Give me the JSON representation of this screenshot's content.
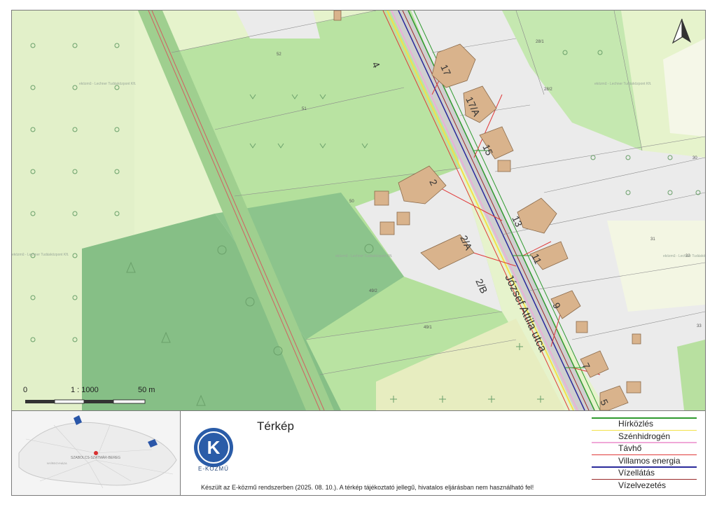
{
  "map": {
    "street_name": "József Attila utca",
    "house_numbers": [
      "17",
      "17/A",
      "15",
      "13",
      "11",
      "9",
      "7",
      "5",
      "2",
      "2/A",
      "2/B",
      "4"
    ],
    "parcel_numbers": [
      "52",
      "51",
      "50",
      "49/2",
      "49/1",
      "28/1",
      "28/2",
      "30",
      "31",
      "32",
      "33"
    ],
    "watermark": "eközmű - Lechner Tudásközpont Kft.",
    "scale": {
      "zero": "0",
      "ratio": "1 : 1000",
      "end": "50 m"
    },
    "north_icon": "north-arrow-icon"
  },
  "minimap": {
    "region_label": "SZABOLCS-SZATMÁR-BEREG",
    "city_label": "NYÍREGYHÁZA"
  },
  "footer": {
    "title": "Térkép",
    "logo_letter": "K",
    "logo_text": "E-KÖZMŰ",
    "note": "Készült az E-közmű rendszerben (2025. 08. 10.). A térkép tájékoztató jellegű, hivatalos eljárásban nem használható fel!"
  },
  "legend": [
    {
      "label": "Hírközlés",
      "color": "#2e9a2e"
    },
    {
      "label": "Szénhidrogén",
      "color": "#f2e24a"
    },
    {
      "label": "Távhő",
      "color": "#f0a8d8"
    },
    {
      "label": "Villamos energia",
      "color": "#e03a3a"
    },
    {
      "label": "Vízellátás",
      "color": "#2a2a9a"
    },
    {
      "label": "Vízelvezetés",
      "color": "#9a2a2a"
    }
  ],
  "colors": {
    "light_green": "#e6f3cc",
    "mid_green": "#b8e0a0",
    "dark_green": "#7fb87f",
    "building": "#d9b38c",
    "built_area": "#ebebeb",
    "yellow_field": "#e7edc0"
  }
}
